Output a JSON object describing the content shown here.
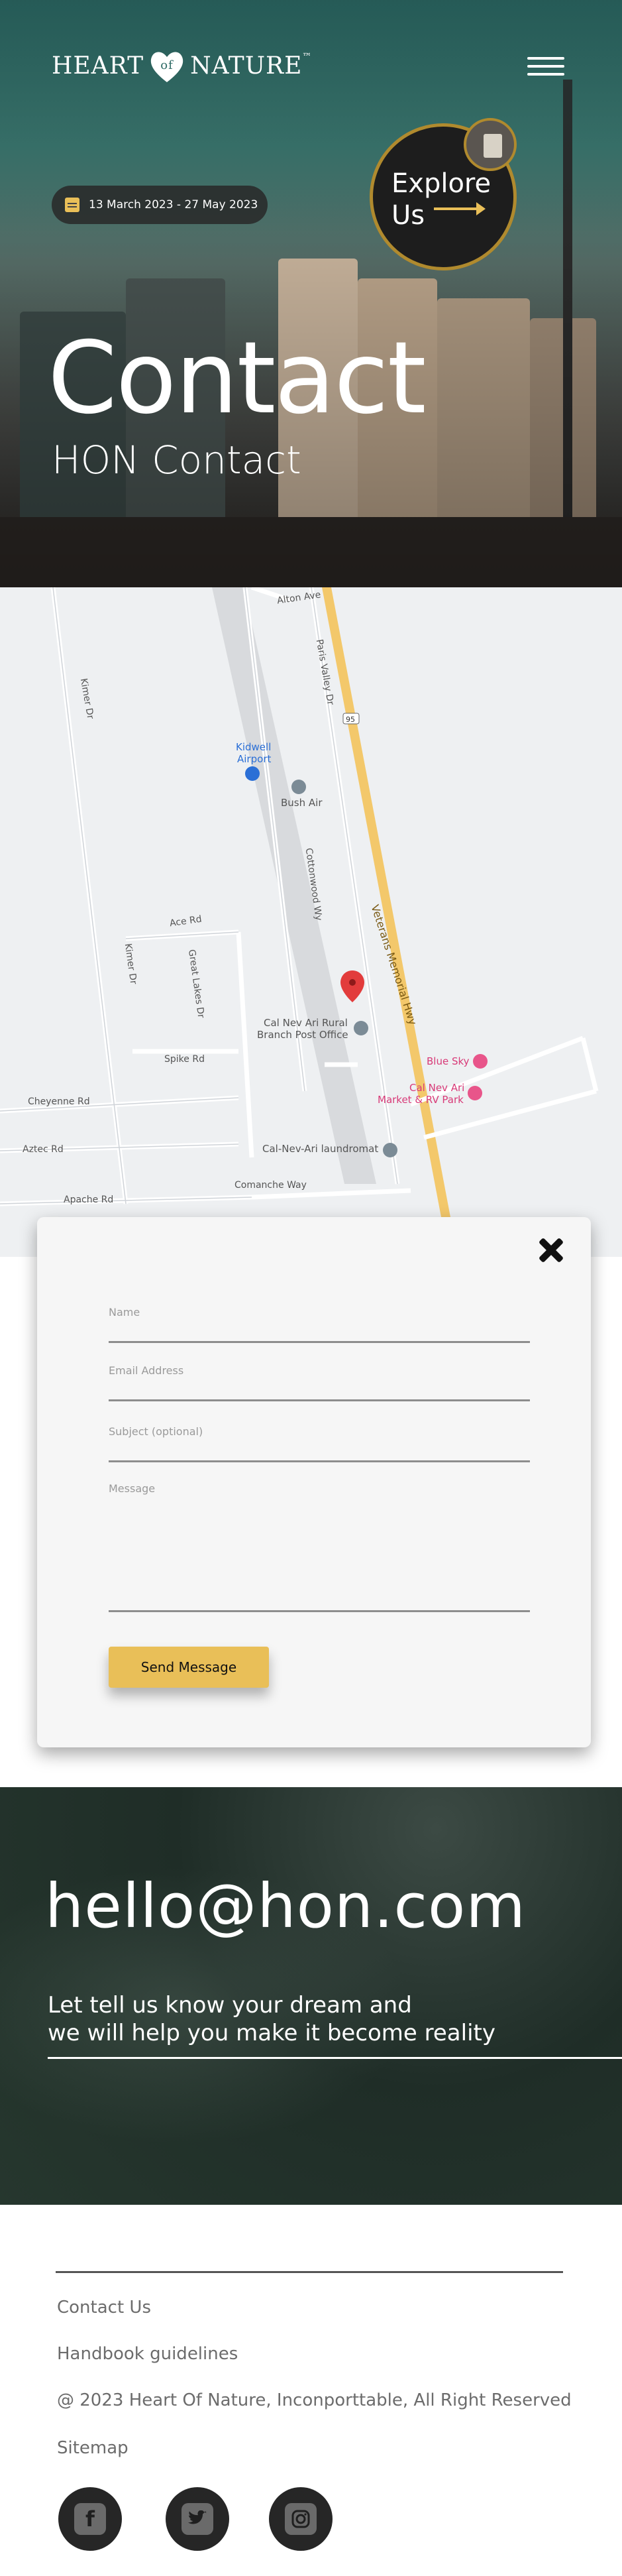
{
  "header": {
    "logo_left": "HEART",
    "logo_of": "of",
    "logo_right": "NATURE",
    "logo_tm": "™",
    "menu_icon": "hamburger-menu-icon"
  },
  "hero": {
    "date_range": "13 March 2023 - 27 May 2023",
    "explore_line1": "Explore",
    "explore_line2": "Us",
    "title": "Contact",
    "subtitle": "HON Contact",
    "accent_color": "#e9bf58"
  },
  "map": {
    "roads": [
      "Alton Ave",
      "Kimer Dr",
      "Paris Valley Dr",
      "Kidwell Airport",
      "Bush Air",
      "Cottonwood Wy",
      "Veterans Memorial Hwy",
      "Ace Rd",
      "Kimer Dr",
      "Great Lakes Dr",
      "Spike Rd",
      "Cheyenne Rd",
      "Aztec Rd",
      "Apache Rd",
      "Comanche Way",
      "Cal Nev Ari Rural Branch Post Office",
      "Blue Sky",
      "Cal Nev Ari Market & RV Park",
      "Cal-Nev-Ari laundromat",
      "95"
    ],
    "labels": {
      "alton": "Alton Ave",
      "kimer": "Kimer Dr",
      "paris": "Paris Valley Dr",
      "airport1": "Kidwell",
      "airport2": "Airport",
      "bushair": "Bush Air",
      "cottonwood": "Cottonwood Wy",
      "highway": "Veterans Memorial Hwy",
      "ace": "Ace Rd",
      "kimer2": "Kimer Dr",
      "greatlakes": "Great Lakes Dr",
      "spike": "Spike Rd",
      "cheyenne": "Cheyenne Rd",
      "aztec": "Aztec Rd",
      "apache": "Apache Rd",
      "comanche": "Comanche Way",
      "postoffice1": "Cal Nev Ari Rural",
      "postoffice2": "Branch Post Office",
      "bluesky": "Blue Sky",
      "market1": "Cal Nev Ari",
      "market2": "Market & RV Park",
      "laundromat": "Cal-Nev-Ari laundromat",
      "route": "95"
    }
  },
  "form": {
    "name_placeholder": "Name",
    "email_placeholder": "Email Address",
    "subject_placeholder": "Subject (optional)",
    "message_placeholder": "Message",
    "send_label": "Send Message",
    "close_icon": "close-icon"
  },
  "contact": {
    "email": "hello@hon.com",
    "tagline_line1": "Let tell us know your dream and",
    "tagline_line2": "we will help you make it become reality"
  },
  "footer": {
    "links": [
      "Contact Us",
      "Handbook guidelines",
      "@ 2023 Heart Of Nature, Inconporttable, All Right Reserved",
      "Sitemap"
    ],
    "social": [
      "facebook-icon",
      "twitter-icon",
      "instagram-icon"
    ]
  }
}
